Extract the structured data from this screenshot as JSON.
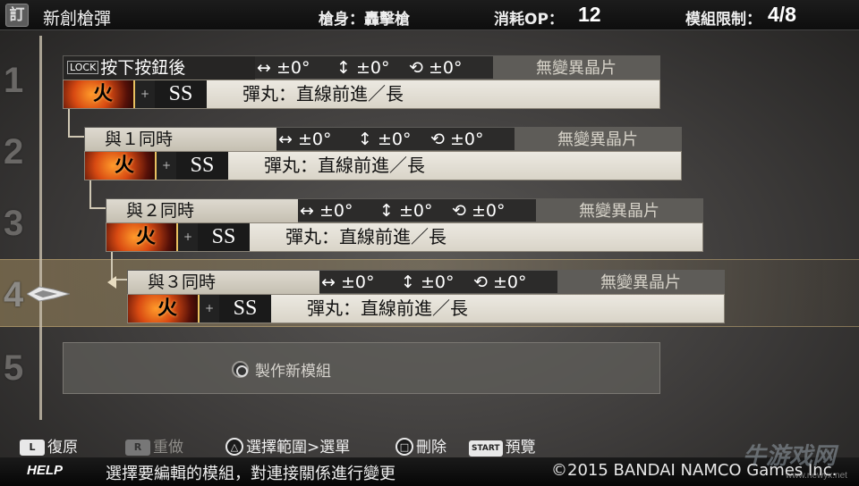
{
  "header": {
    "logo_glyph": "訂",
    "title": "新創槍彈",
    "gun_label": "槍身：轟擊槍",
    "op_label": "消耗OP：",
    "op_value": "12",
    "limit_label": "模組限制：",
    "limit_value": "4/8"
  },
  "row_numbers": [
    "1",
    "2",
    "3",
    "4",
    "5"
  ],
  "selected_row": 4,
  "modules": [
    {
      "lock": "LOCK",
      "trigger": "按下按鈕後",
      "h_adjust": "↔ ±0°",
      "v_adjust": "↕ ±0°",
      "r_adjust": "⟲ ±0°",
      "crystal": "無變異晶片",
      "element": "火",
      "plus": "+",
      "grade": "SS",
      "bullet": "彈丸：直線前進／長"
    },
    {
      "trigger": "與１同時",
      "h_adjust": "↔ ±0°",
      "v_adjust": "↕ ±0°",
      "r_adjust": "⟲ ±0°",
      "crystal": "無變異晶片",
      "element": "火",
      "plus": "+",
      "grade": "SS",
      "bullet": "彈丸：直線前進／長"
    },
    {
      "trigger": "與２同時",
      "h_adjust": "↔ ±0°",
      "v_adjust": "↕ ±0°",
      "r_adjust": "⟲ ±0°",
      "crystal": "無變異晶片",
      "element": "火",
      "plus": "+",
      "grade": "SS",
      "bullet": "彈丸：直線前進／長"
    },
    {
      "trigger": "與３同時",
      "h_adjust": "↔ ±0°",
      "v_adjust": "↕ ±0°",
      "r_adjust": "⟲ ±0°",
      "crystal": "無變異晶片",
      "element": "火",
      "plus": "+",
      "grade": "SS",
      "bullet": "彈丸：直線前進／長"
    }
  ],
  "new_module": {
    "label": "製作新模組",
    "icon": "circle-button-icon"
  },
  "controls": {
    "undo": {
      "key": "L",
      "label": "復原"
    },
    "redo": {
      "key": "R",
      "label": "重做"
    },
    "select": {
      "key": "△",
      "label": "選擇範圍>選單"
    },
    "delete": {
      "key": "□",
      "label": "刪除"
    },
    "preview": {
      "key": "START",
      "label": "預覽"
    }
  },
  "help": {
    "label": "HELP",
    "message": "選擇要編輯的模組，對連接關係進行變更",
    "copyright": "©2015 BANDAI NAMCO Games Inc."
  },
  "watermark": {
    "text": "牛游戏网",
    "url": "www.newyx.net"
  },
  "colors": {
    "header_bg": "#151515",
    "trigger_bg": "#d4cfc3",
    "bullet_bg": "#e6e2d9",
    "crystal_bg": "#5e5c58",
    "fire_element": "#d84a12",
    "selection_highlight": "#c8aa6e"
  }
}
